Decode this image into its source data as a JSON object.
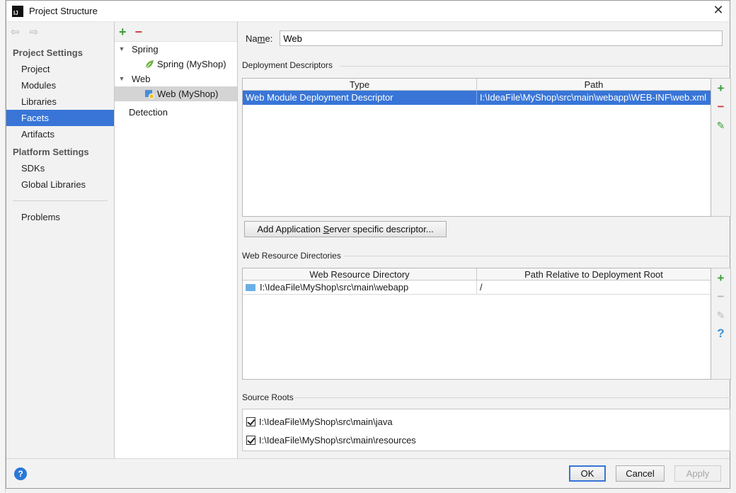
{
  "window": {
    "title": "Project Structure"
  },
  "nav": {
    "project_settings_header": "Project Settings",
    "project_settings_items": [
      "Project",
      "Modules",
      "Libraries",
      "Facets",
      "Artifacts"
    ],
    "selected": "Facets",
    "platform_settings_header": "Platform Settings",
    "platform_settings_items": [
      "SDKs",
      "Global Libraries"
    ],
    "problems": "Problems"
  },
  "tree": {
    "nodes": [
      {
        "label": "Spring",
        "level": 0,
        "expanded": true
      },
      {
        "label": "Spring (MyShop)",
        "level": 1,
        "icon": "spring-leaf-icon"
      },
      {
        "label": "Web",
        "level": 0,
        "expanded": true
      },
      {
        "label": "Web (MyShop)",
        "level": 1,
        "icon": "web-facet-icon",
        "selected": true
      },
      {
        "label": "Detection",
        "level": 0
      }
    ]
  },
  "form": {
    "name_label_pre": "Na",
    "name_label_mn": "m",
    "name_label_post": "e:",
    "name_value": "Web"
  },
  "deployment": {
    "title": "Deployment Descriptors",
    "columns": [
      "Type",
      "Path"
    ],
    "rows": [
      {
        "type": "Web Module Deployment Descriptor",
        "path": "I:\\IdeaFile\\MyShop\\src\\main\\webapp\\WEB-INF\\web.xml",
        "selected": true
      }
    ],
    "add_server_pre": "Add Application ",
    "add_server_mn": "S",
    "add_server_post": "erver specific descriptor..."
  },
  "resources": {
    "title": "Web Resource Directories",
    "columns": [
      "Web Resource Directory",
      "Path Relative to Deployment Root"
    ],
    "rows": [
      {
        "dir": "I:\\IdeaFile\\MyShop\\src\\main\\webapp",
        "rel": "/"
      }
    ]
  },
  "source_roots": {
    "title": "Source Roots",
    "items": [
      {
        "path": "I:\\IdeaFile\\MyShop\\src\\main\\java",
        "checked": true
      },
      {
        "path": "I:\\IdeaFile\\MyShop\\src\\main\\resources",
        "checked": true
      }
    ]
  },
  "buttons": {
    "ok": "OK",
    "cancel": "Cancel",
    "apply": "Apply"
  },
  "colors": {
    "selection": "#3875d7",
    "add": "#3aa03a",
    "remove": "#d04040",
    "help": "#2a78d6"
  }
}
